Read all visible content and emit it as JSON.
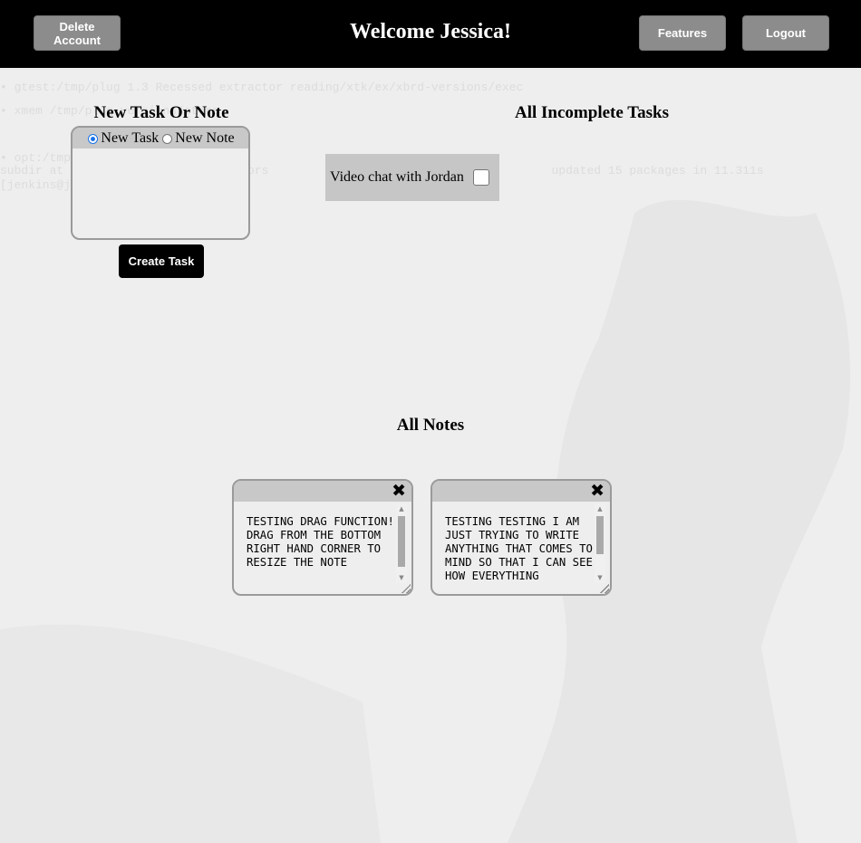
{
  "header": {
    "delete_label": "Delete Account",
    "welcome": "Welcome Jessica!",
    "features_label": "Features",
    "logout_label": "Logout"
  },
  "create_form": {
    "title": "New Task Or Note",
    "radio_task": "New Task",
    "radio_note": "New Note",
    "selected": "New Task",
    "button_label": "Create Task"
  },
  "tasks": {
    "title": "All Incomplete Tasks",
    "items": [
      {
        "label": "Video chat with Jordan",
        "checked": false
      }
    ]
  },
  "notes": {
    "title": "All Notes",
    "items": [
      {
        "text": "TESTING DRAG FUNCTION! DRAG FROM THE BOTTOM RIGHT HAND CORNER TO RESIZE THE NOTE"
      },
      {
        "text": "TESTING TESTING I AM JUST TRYING TO WRITE ANYTHING THAT COMES TO MIND SO THAT I CAN SEE HOW EVERYTHING"
      }
    ]
  }
}
